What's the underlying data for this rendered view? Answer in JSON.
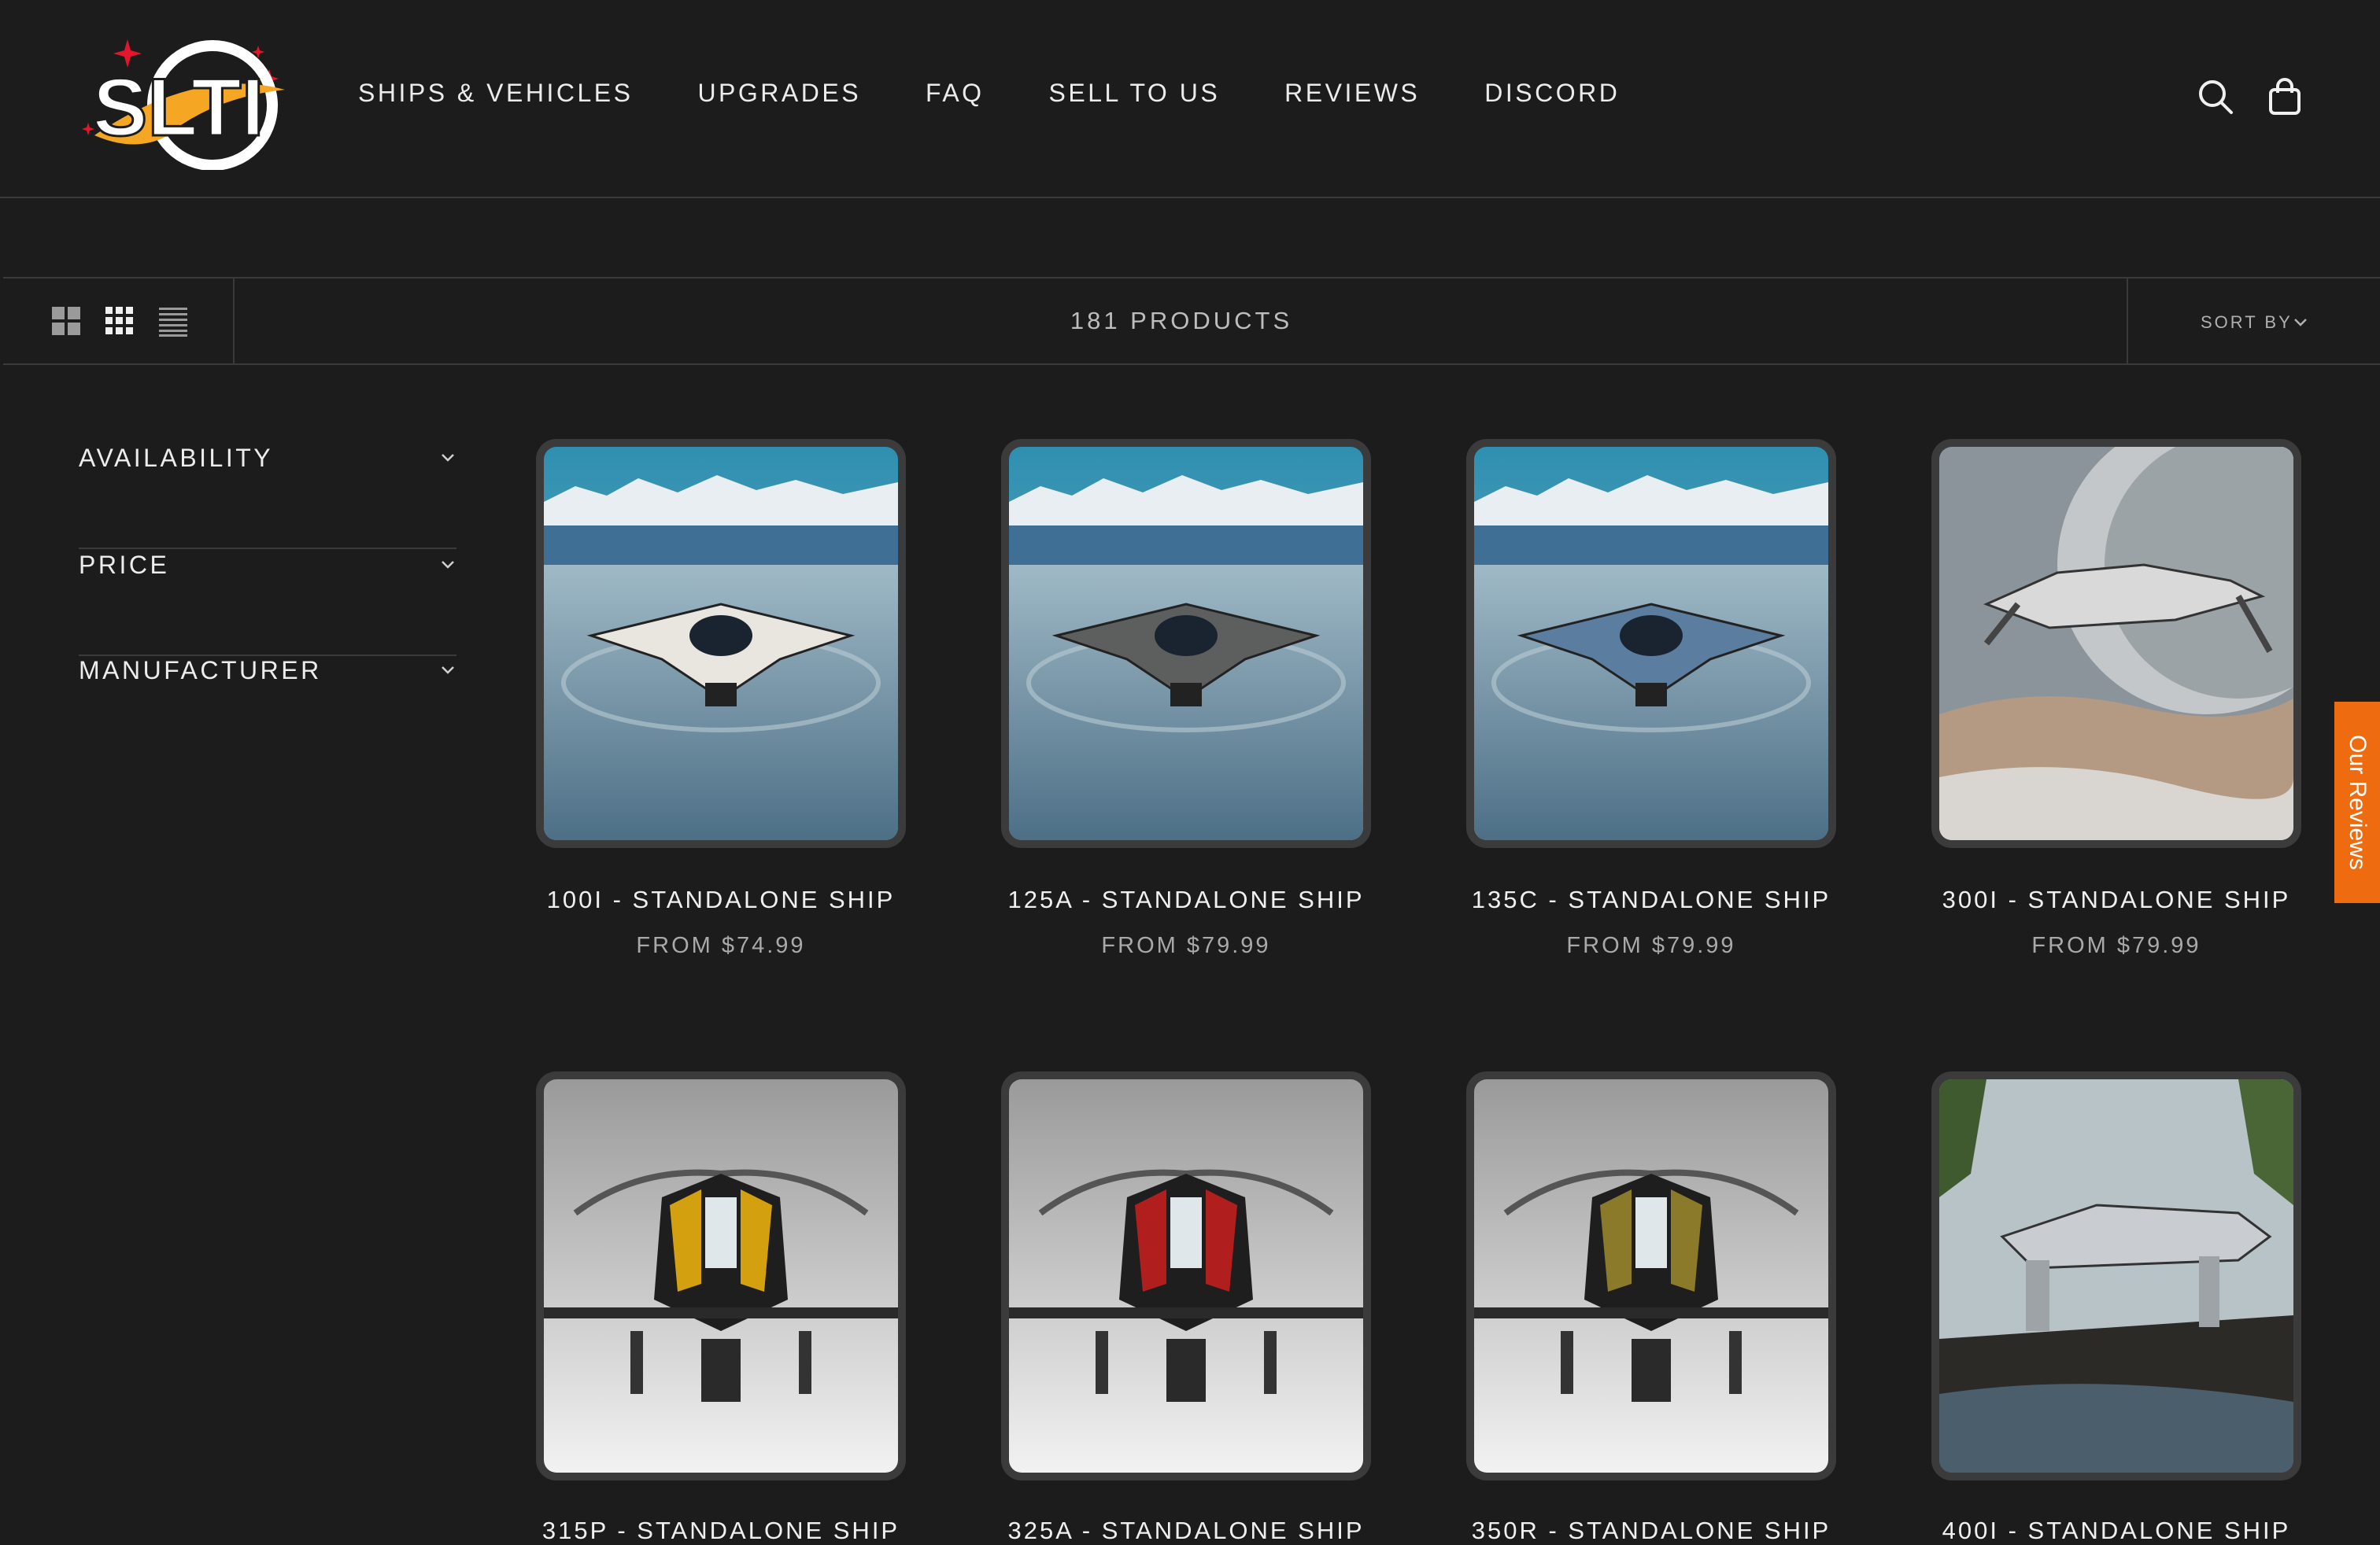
{
  "brand": {
    "logo_text": "SLTI",
    "accent": "#f5a623",
    "star_color": "#e3162b"
  },
  "nav": [
    "SHIPS & VEHICLES",
    "UPGRADES",
    "FAQ",
    "SELL TO US",
    "REVIEWS",
    "DISCORD"
  ],
  "header_icons": [
    "search-icon",
    "shopping-bag-icon"
  ],
  "toolbar": {
    "view_icons": [
      "grid-large-icon",
      "grid-small-icon",
      "list-icon"
    ],
    "count": "181 PRODUCTS",
    "sort_label": "SORT BY"
  },
  "filters": [
    "AVAILABILITY",
    "PRICE",
    "MANUFACTURER"
  ],
  "products": [
    {
      "title": "100I - STANDALONE SHIP",
      "price": "FROM $74.99",
      "scene": "mountain",
      "ship": "#e9e6df"
    },
    {
      "title": "125A - STANDALONE SHIP",
      "price": "FROM $79.99",
      "scene": "mountain",
      "ship": "#5d5f5e"
    },
    {
      "title": "135C - STANDALONE SHIP",
      "price": "FROM $79.99",
      "scene": "mountain",
      "ship": "#5b7ea0"
    },
    {
      "title": "300I - STANDALONE SHIP",
      "price": "FROM $79.99",
      "scene": "planet",
      "ship": "#d9d9d9"
    },
    {
      "title": "315P - STANDALONE SHIP",
      "price": "",
      "scene": "studio",
      "ship": "#d3a10f"
    },
    {
      "title": "325A - STANDALONE SHIP",
      "price": "",
      "scene": "studio",
      "ship": "#b01e1e"
    },
    {
      "title": "350R - STANDALONE SHIP",
      "price": "",
      "scene": "studio",
      "ship": "#8a7a2a"
    },
    {
      "title": "400I - STANDALONE SHIP",
      "price": "",
      "scene": "forest",
      "ship": "#c9ccd0"
    }
  ],
  "reviews_tab": "Our Reviews",
  "colors": {
    "background": "#1c1c1c",
    "divider": "#3a3a3a",
    "card_border": "#3b3b3b",
    "reviews_tab": "#ee6b0f"
  }
}
